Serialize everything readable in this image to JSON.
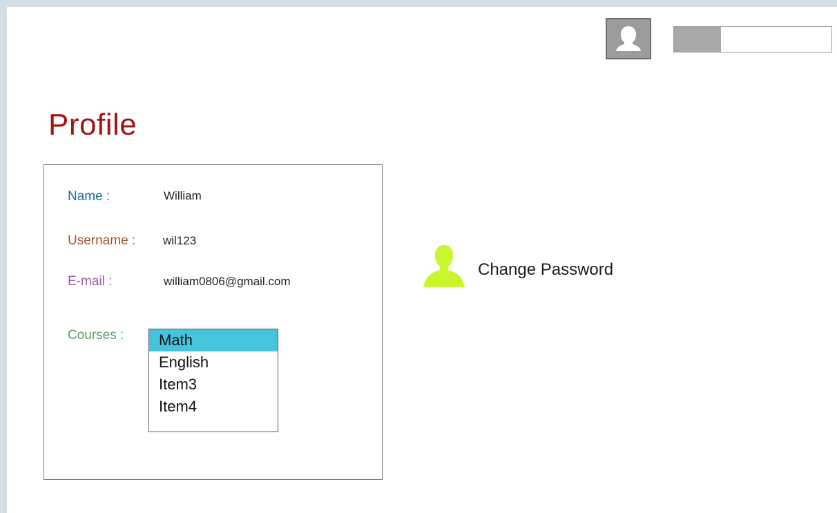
{
  "header": {
    "avatar_icon": "user-silhouette-icon",
    "progress_value": 0.3
  },
  "page": {
    "title": "Profile"
  },
  "profile": {
    "name_label": "Name :",
    "name_value": "William",
    "username_label": "Username :",
    "username_value": "wil123",
    "email_label": "E-mail :",
    "email_value": "william0806@gmail.com",
    "courses_label": "Courses :",
    "courses": [
      "Math",
      "English",
      "Item3",
      "Item4"
    ],
    "selected_course_index": 0
  },
  "actions": {
    "change_password_label": "Change Password",
    "change_password_icon": "person-icon"
  },
  "colors": {
    "title": "#a11515",
    "name_label": "#1f6c9a",
    "username_label": "#a2522b",
    "email_label": "#a15aa2",
    "courses_label": "#5c9a68",
    "selected_item": "#45c4db",
    "person_icon": "#c8f52e"
  }
}
